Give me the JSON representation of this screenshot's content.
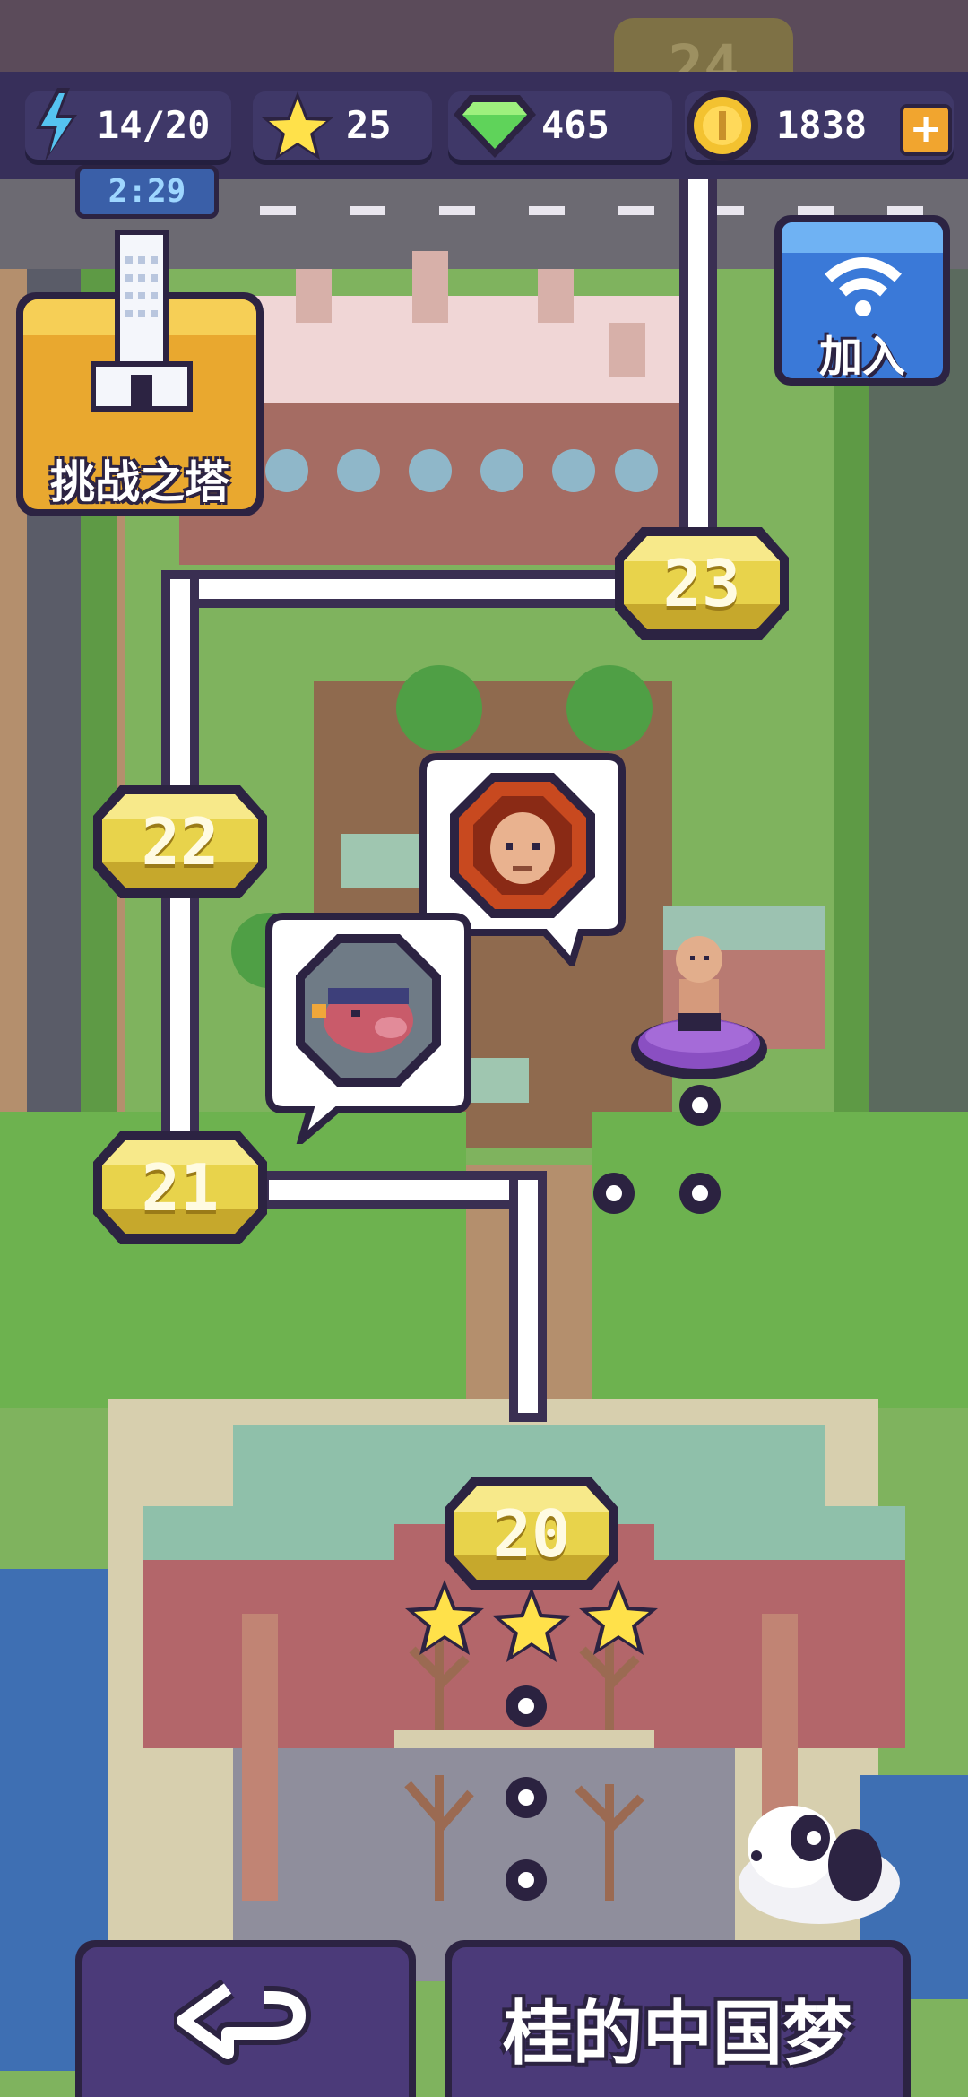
{
  "hud": {
    "energy": "14/20",
    "energy_timer": "2:29",
    "stars": "25",
    "gems": "465",
    "coins": "1838"
  },
  "buttons": {
    "tower_label": "挑战之塔",
    "join_label": "加入",
    "back_icon": "back-arrow-icon"
  },
  "levels": {
    "top_faded": "24",
    "l23": "23",
    "l22": "22",
    "l21": "21",
    "l20": "20"
  },
  "level_20_stars": 3,
  "chapter_title": "桂的中国梦",
  "colors": {
    "hud_bg": "#3f3868",
    "node_gold": "#e6d04a",
    "path_white": "#ffffff",
    "player_base": "#8a4fc2"
  }
}
